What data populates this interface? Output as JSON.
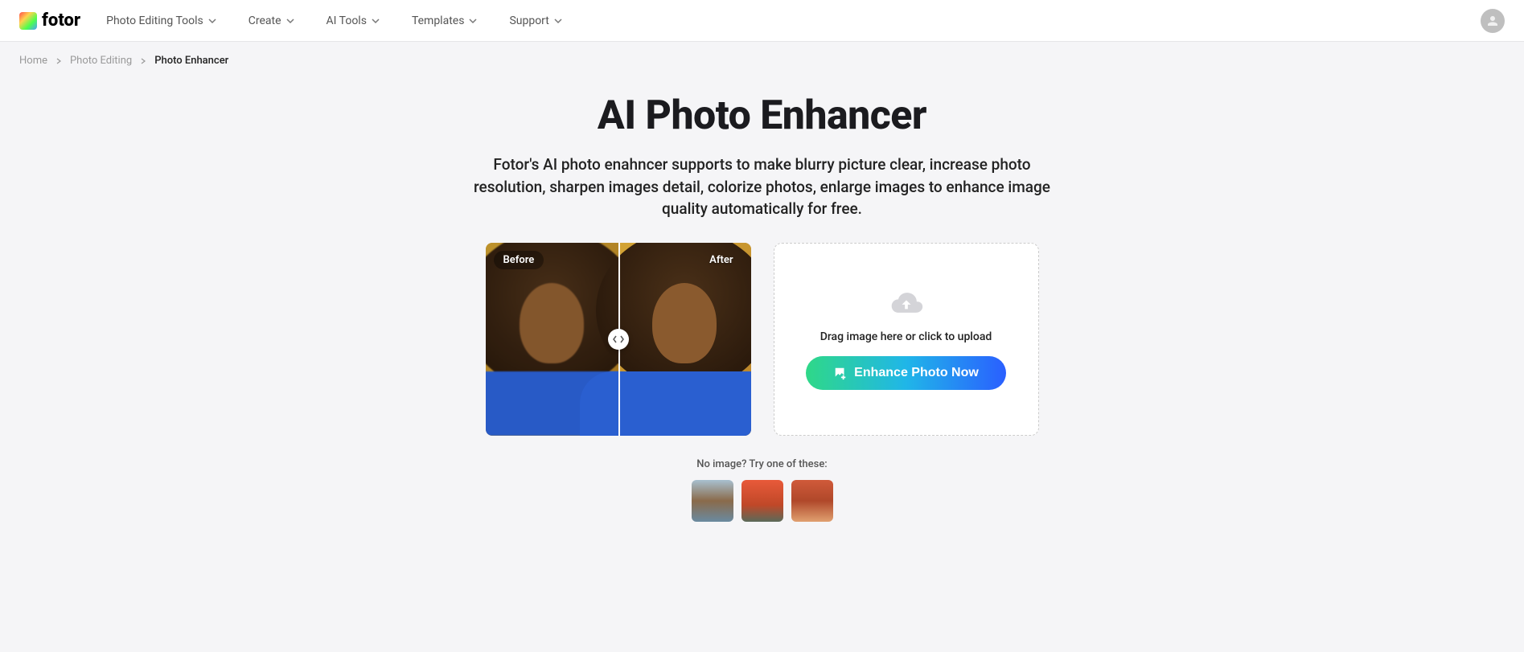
{
  "logo": {
    "text": "fotor"
  },
  "nav": {
    "items": [
      {
        "label": "Photo Editing Tools"
      },
      {
        "label": "Create"
      },
      {
        "label": "AI Tools"
      },
      {
        "label": "Templates"
      },
      {
        "label": "Support"
      }
    ]
  },
  "breadcrumb": {
    "items": [
      {
        "label": "Home"
      },
      {
        "label": "Photo Editing"
      }
    ],
    "current": "Photo Enhancer"
  },
  "hero": {
    "title": "AI Photo Enhancer",
    "subtitle": "Fotor's AI photo enahncer supports to make blurry picture clear, increase photo resolution, sharpen images detail, colorize photos, enlarge images to enhance image quality automatically for free."
  },
  "preview": {
    "before_label": "Before",
    "after_label": "After"
  },
  "upload": {
    "drag_text": "Drag image here or click to upload",
    "button_label": "Enhance Photo Now"
  },
  "samples": {
    "label": "No image? Try one of these:"
  }
}
